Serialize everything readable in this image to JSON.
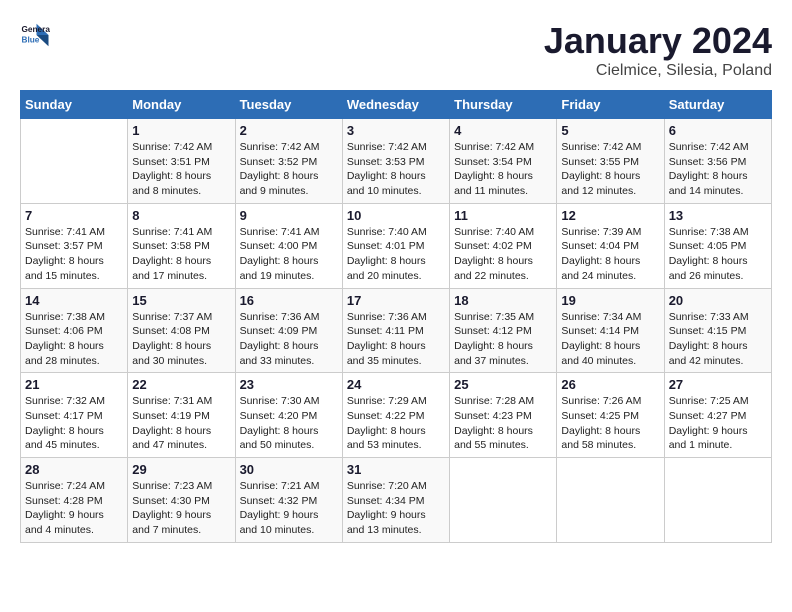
{
  "logo": {
    "line1": "General",
    "line2": "Blue"
  },
  "title": "January 2024",
  "subtitle": "Cielmice, Silesia, Poland",
  "days_of_week": [
    "Sunday",
    "Monday",
    "Tuesday",
    "Wednesday",
    "Thursday",
    "Friday",
    "Saturday"
  ],
  "weeks": [
    [
      {
        "day": "",
        "sunrise": "",
        "sunset": "",
        "daylight": ""
      },
      {
        "day": "1",
        "sunrise": "Sunrise: 7:42 AM",
        "sunset": "Sunset: 3:51 PM",
        "daylight": "Daylight: 8 hours and 8 minutes."
      },
      {
        "day": "2",
        "sunrise": "Sunrise: 7:42 AM",
        "sunset": "Sunset: 3:52 PM",
        "daylight": "Daylight: 8 hours and 9 minutes."
      },
      {
        "day": "3",
        "sunrise": "Sunrise: 7:42 AM",
        "sunset": "Sunset: 3:53 PM",
        "daylight": "Daylight: 8 hours and 10 minutes."
      },
      {
        "day": "4",
        "sunrise": "Sunrise: 7:42 AM",
        "sunset": "Sunset: 3:54 PM",
        "daylight": "Daylight: 8 hours and 11 minutes."
      },
      {
        "day": "5",
        "sunrise": "Sunrise: 7:42 AM",
        "sunset": "Sunset: 3:55 PM",
        "daylight": "Daylight: 8 hours and 12 minutes."
      },
      {
        "day": "6",
        "sunrise": "Sunrise: 7:42 AM",
        "sunset": "Sunset: 3:56 PM",
        "daylight": "Daylight: 8 hours and 14 minutes."
      }
    ],
    [
      {
        "day": "7",
        "sunrise": "Sunrise: 7:41 AM",
        "sunset": "Sunset: 3:57 PM",
        "daylight": "Daylight: 8 hours and 15 minutes."
      },
      {
        "day": "8",
        "sunrise": "Sunrise: 7:41 AM",
        "sunset": "Sunset: 3:58 PM",
        "daylight": "Daylight: 8 hours and 17 minutes."
      },
      {
        "day": "9",
        "sunrise": "Sunrise: 7:41 AM",
        "sunset": "Sunset: 4:00 PM",
        "daylight": "Daylight: 8 hours and 19 minutes."
      },
      {
        "day": "10",
        "sunrise": "Sunrise: 7:40 AM",
        "sunset": "Sunset: 4:01 PM",
        "daylight": "Daylight: 8 hours and 20 minutes."
      },
      {
        "day": "11",
        "sunrise": "Sunrise: 7:40 AM",
        "sunset": "Sunset: 4:02 PM",
        "daylight": "Daylight: 8 hours and 22 minutes."
      },
      {
        "day": "12",
        "sunrise": "Sunrise: 7:39 AM",
        "sunset": "Sunset: 4:04 PM",
        "daylight": "Daylight: 8 hours and 24 minutes."
      },
      {
        "day": "13",
        "sunrise": "Sunrise: 7:38 AM",
        "sunset": "Sunset: 4:05 PM",
        "daylight": "Daylight: 8 hours and 26 minutes."
      }
    ],
    [
      {
        "day": "14",
        "sunrise": "Sunrise: 7:38 AM",
        "sunset": "Sunset: 4:06 PM",
        "daylight": "Daylight: 8 hours and 28 minutes."
      },
      {
        "day": "15",
        "sunrise": "Sunrise: 7:37 AM",
        "sunset": "Sunset: 4:08 PM",
        "daylight": "Daylight: 8 hours and 30 minutes."
      },
      {
        "day": "16",
        "sunrise": "Sunrise: 7:36 AM",
        "sunset": "Sunset: 4:09 PM",
        "daylight": "Daylight: 8 hours and 33 minutes."
      },
      {
        "day": "17",
        "sunrise": "Sunrise: 7:36 AM",
        "sunset": "Sunset: 4:11 PM",
        "daylight": "Daylight: 8 hours and 35 minutes."
      },
      {
        "day": "18",
        "sunrise": "Sunrise: 7:35 AM",
        "sunset": "Sunset: 4:12 PM",
        "daylight": "Daylight: 8 hours and 37 minutes."
      },
      {
        "day": "19",
        "sunrise": "Sunrise: 7:34 AM",
        "sunset": "Sunset: 4:14 PM",
        "daylight": "Daylight: 8 hours and 40 minutes."
      },
      {
        "day": "20",
        "sunrise": "Sunrise: 7:33 AM",
        "sunset": "Sunset: 4:15 PM",
        "daylight": "Daylight: 8 hours and 42 minutes."
      }
    ],
    [
      {
        "day": "21",
        "sunrise": "Sunrise: 7:32 AM",
        "sunset": "Sunset: 4:17 PM",
        "daylight": "Daylight: 8 hours and 45 minutes."
      },
      {
        "day": "22",
        "sunrise": "Sunrise: 7:31 AM",
        "sunset": "Sunset: 4:19 PM",
        "daylight": "Daylight: 8 hours and 47 minutes."
      },
      {
        "day": "23",
        "sunrise": "Sunrise: 7:30 AM",
        "sunset": "Sunset: 4:20 PM",
        "daylight": "Daylight: 8 hours and 50 minutes."
      },
      {
        "day": "24",
        "sunrise": "Sunrise: 7:29 AM",
        "sunset": "Sunset: 4:22 PM",
        "daylight": "Daylight: 8 hours and 53 minutes."
      },
      {
        "day": "25",
        "sunrise": "Sunrise: 7:28 AM",
        "sunset": "Sunset: 4:23 PM",
        "daylight": "Daylight: 8 hours and 55 minutes."
      },
      {
        "day": "26",
        "sunrise": "Sunrise: 7:26 AM",
        "sunset": "Sunset: 4:25 PM",
        "daylight": "Daylight: 8 hours and 58 minutes."
      },
      {
        "day": "27",
        "sunrise": "Sunrise: 7:25 AM",
        "sunset": "Sunset: 4:27 PM",
        "daylight": "Daylight: 9 hours and 1 minute."
      }
    ],
    [
      {
        "day": "28",
        "sunrise": "Sunrise: 7:24 AM",
        "sunset": "Sunset: 4:28 PM",
        "daylight": "Daylight: 9 hours and 4 minutes."
      },
      {
        "day": "29",
        "sunrise": "Sunrise: 7:23 AM",
        "sunset": "Sunset: 4:30 PM",
        "daylight": "Daylight: 9 hours and 7 minutes."
      },
      {
        "day": "30",
        "sunrise": "Sunrise: 7:21 AM",
        "sunset": "Sunset: 4:32 PM",
        "daylight": "Daylight: 9 hours and 10 minutes."
      },
      {
        "day": "31",
        "sunrise": "Sunrise: 7:20 AM",
        "sunset": "Sunset: 4:34 PM",
        "daylight": "Daylight: 9 hours and 13 minutes."
      },
      {
        "day": "",
        "sunrise": "",
        "sunset": "",
        "daylight": ""
      },
      {
        "day": "",
        "sunrise": "",
        "sunset": "",
        "daylight": ""
      },
      {
        "day": "",
        "sunrise": "",
        "sunset": "",
        "daylight": ""
      }
    ]
  ]
}
